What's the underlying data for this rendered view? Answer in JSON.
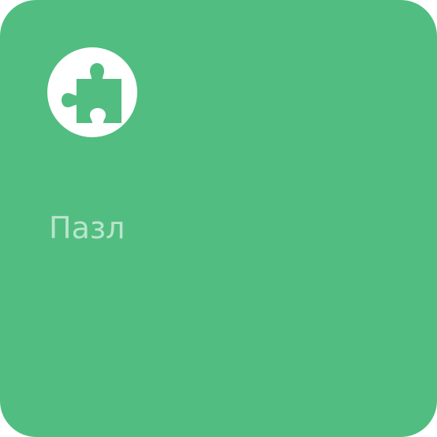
{
  "tile": {
    "label": "Пазл",
    "icon": "puzzle-piece-icon",
    "background_color": "#52bd80",
    "icon_background_color": "#ffffff",
    "label_color": "rgba(255,255,255,0.6)"
  }
}
